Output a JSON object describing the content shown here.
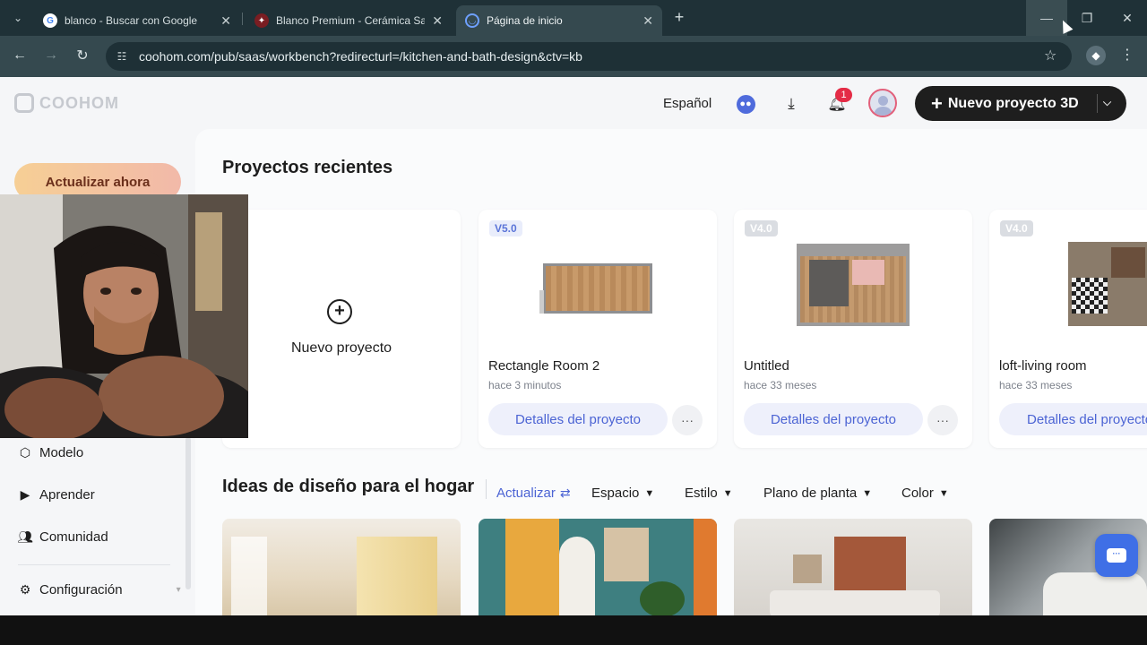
{
  "browser": {
    "tabs": [
      {
        "title": "blanco - Buscar con Google",
        "favicon": "google-icon"
      },
      {
        "title": "Blanco Premium - Cerámica San Lo",
        "favicon": "ceramica-icon"
      },
      {
        "title": "Página de inicio",
        "favicon": "coohom-icon",
        "active": true
      }
    ],
    "url": "coohom.com/pub/saas/workbench?redirecturl=/kitchen-and-bath-design&ctv=kb"
  },
  "header": {
    "logo": "COOHOM",
    "language": "Español",
    "notifications_count": "1",
    "new_project_label": "Nuevo proyecto 3D"
  },
  "sidebar": {
    "upgrade_label": "Actualizar ahora",
    "items": [
      {
        "label": "Modelo",
        "icon": "cube-icon"
      },
      {
        "label": "Aprender",
        "icon": "play-screen-icon"
      },
      {
        "label": "Comunidad",
        "icon": "people-icon"
      },
      {
        "label": "Configuración",
        "icon": "gear-icon"
      }
    ]
  },
  "recent": {
    "title": "Proyectos recientes",
    "new_project_label": "Nuevo proyecto",
    "details_label": "Detalles del proyecto",
    "projects": [
      {
        "version": "V5.0",
        "name": "Rectangle Room 2",
        "modified": "hace 3 minutos"
      },
      {
        "version": "V4.0",
        "name": "Untitled",
        "modified": "hace 33 meses"
      },
      {
        "version": "V4.0",
        "name": "loft-living room",
        "modified": "hace 33 meses"
      }
    ]
  },
  "ideas": {
    "title": "Ideas de diseño para el hogar",
    "refresh_label": "Actualizar",
    "filters": [
      "Espacio",
      "Estilo",
      "Plano de planta",
      "Color"
    ]
  },
  "colors": {
    "accent": "#4c64d4",
    "dark_button": "#1e1e1e",
    "upgrade_gradient": "#f6cf95"
  }
}
